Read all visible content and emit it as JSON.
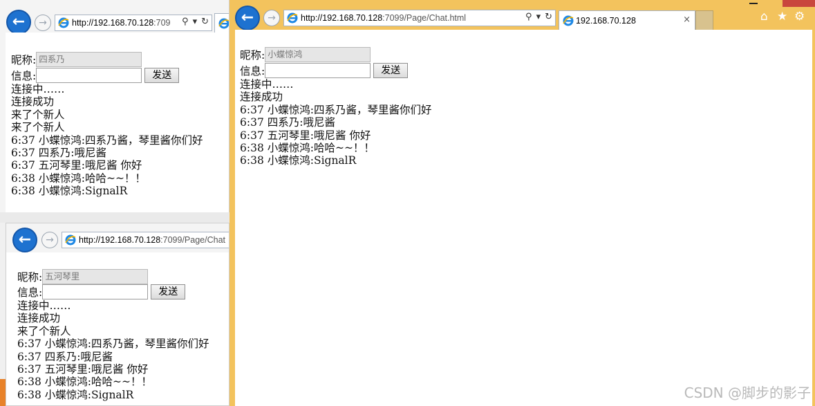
{
  "colors": {
    "accent_blue": "#1e72d0",
    "frame_orange": "#f3c35d",
    "close_red": "#c9463d"
  },
  "window_a": {
    "address": {
      "host": "http://192.168.70.128",
      "rest": ":709"
    },
    "nickname_label": "昵称:",
    "nickname_value": "四系乃",
    "message_label": "信息:",
    "message_value": "",
    "send_label": "发送",
    "log": [
      "连接中……",
      "连接成功",
      "来了个新人",
      "来了个新人",
      "6:37 小蝶惊鸿:四系乃酱，琴里酱你们好",
      "6:37 四系乃:哦尼酱",
      "6:37 五河琴里:哦尼酱 你好",
      "6:38 小蝶惊鸿:哈哈~~！！",
      "6:38 小蝶惊鸿:SignalR"
    ]
  },
  "window_b": {
    "address": {
      "host": "http://192.168.70.128",
      "rest": ":7099/Page/Chat"
    },
    "nickname_label": "昵称:",
    "nickname_value": "五河琴里",
    "message_label": "信息:",
    "message_value": "",
    "send_label": "发送",
    "log": [
      "连接中……",
      "连接成功",
      "来了个新人",
      "6:37 小蝶惊鸿:四系乃酱，琴里酱你们好",
      "6:37 四系乃:哦尼酱",
      "6:37 五河琴里:哦尼酱 你好",
      "6:38 小蝶惊鸿:哈哈~~！！",
      "6:38 小蝶惊鸿:SignalR"
    ]
  },
  "window_c": {
    "address": {
      "host": "http://192.168.70.128",
      "rest": ":7099/Page/Chat.html"
    },
    "tab_title": "192.168.70.128",
    "nickname_label": "昵称:",
    "nickname_value": "小蝶惊鸿",
    "message_label": "信息:",
    "message_value": "",
    "send_label": "发送",
    "log": [
      "连接中……",
      "连接成功",
      "6:37 小蝶惊鸿:四系乃酱，琴里酱你们好",
      "6:37 四系乃:哦尼酱",
      "6:37 五河琴里:哦尼酱 你好",
      "6:38 小蝶惊鸿:哈哈~~！！",
      "6:38 小蝶惊鸿:SignalR"
    ]
  },
  "icons": {
    "back": "←",
    "forward": "→",
    "search": "⚲",
    "dropdown": "▾",
    "refresh": "↻",
    "close": "×",
    "home": "⌂",
    "star": "★",
    "gear": "⚙"
  },
  "watermark": "CSDN @脚步的影子"
}
